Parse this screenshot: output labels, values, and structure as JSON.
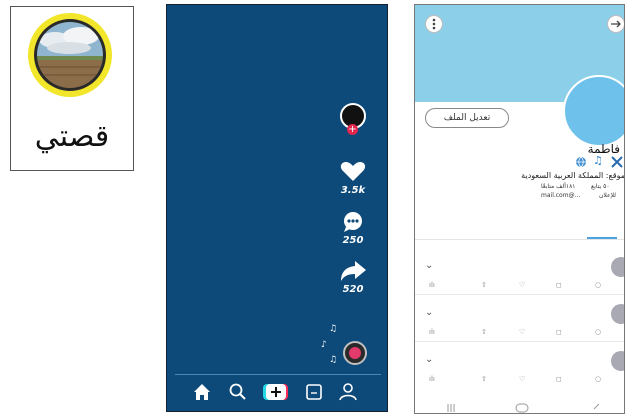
{
  "story": {
    "label": "قصتي"
  },
  "video": {
    "likes": "3.5k",
    "comments": "250",
    "shares": "520",
    "nav_items": [
      "home",
      "search",
      "create",
      "inbox",
      "profile"
    ]
  },
  "profile": {
    "edit_button": "تعديل الملف",
    "name": "فاطمة",
    "location": "الموقع: المملكة العربية السعودية",
    "stat_following": "٥٠ يتابع",
    "stat_followers": "١٨١ألف متابعًا",
    "stat_ads": "للإعلان",
    "email": "...@mail.com",
    "colors": {
      "header": "#8ccfe9",
      "avatar": "#6ec1ea",
      "accent": "#4da3e0",
      "video_bg": "#0d4a79"
    }
  }
}
